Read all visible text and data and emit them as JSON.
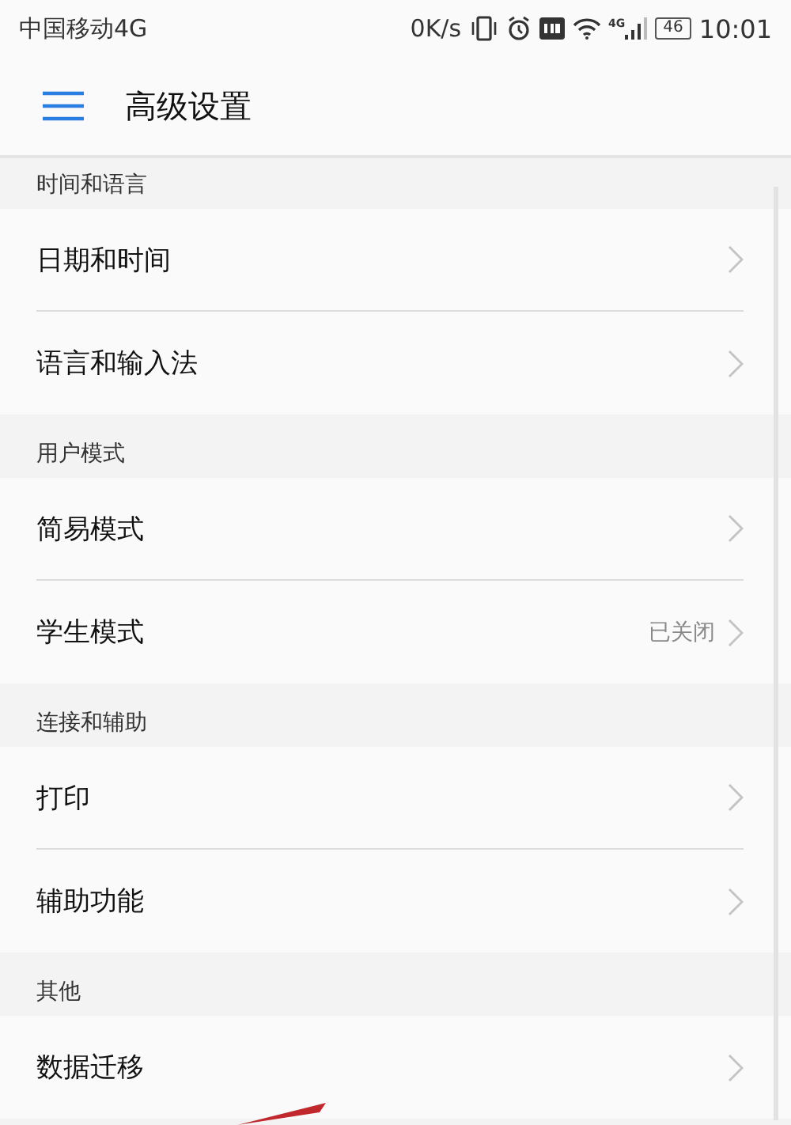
{
  "status_bar": {
    "carrier": "中国移动4G",
    "speed": "0K/s",
    "network": "4G",
    "battery": "46",
    "time": "10:01"
  },
  "header": {
    "title": "高级设置"
  },
  "sections": [
    {
      "title": "时间和语言",
      "items": [
        {
          "label": "日期和时间"
        },
        {
          "label": "语言和输入法"
        }
      ]
    },
    {
      "title": "用户模式",
      "items": [
        {
          "label": "简易模式"
        },
        {
          "label": "学生模式",
          "value": "已关闭"
        }
      ]
    },
    {
      "title": "连接和辅助",
      "items": [
        {
          "label": "打印"
        },
        {
          "label": "辅助功能"
        }
      ]
    },
    {
      "title": "其他",
      "items": [
        {
          "label": "数据迁移"
        }
      ]
    }
  ]
}
